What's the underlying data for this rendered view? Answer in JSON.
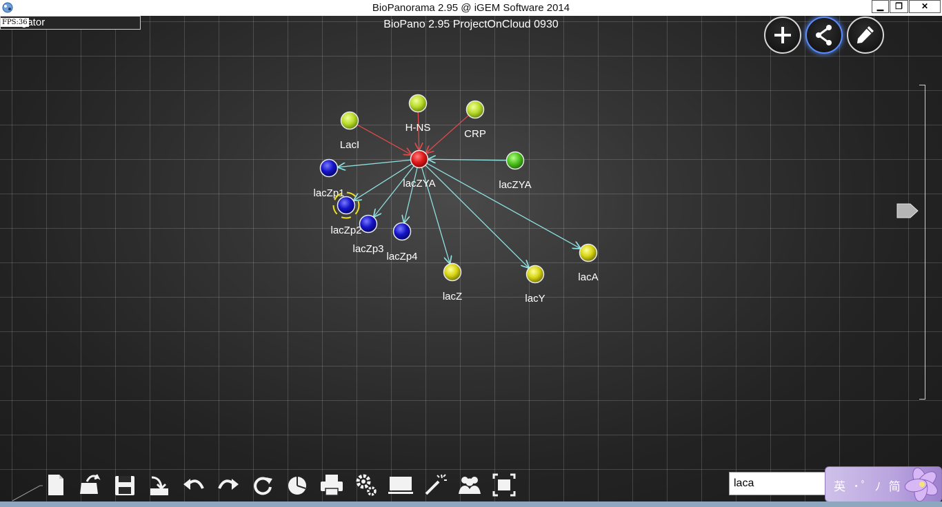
{
  "window": {
    "title": "BioPanorama 2.95 @ iGEM Software 2014",
    "app_icon": "biopanorama-app-icon",
    "minimize_glyph": "▁",
    "maximize_glyph": "❐",
    "close_glyph": "✕"
  },
  "navigator": {
    "label": "gator",
    "fps": "FPS:36"
  },
  "project": {
    "name": "BioPano 2.95 ProjectOnCloud 0930"
  },
  "mode_buttons": [
    {
      "name": "add-icon",
      "active": false
    },
    {
      "name": "share-network-icon",
      "active": true
    },
    {
      "name": "pencil-icon",
      "active": false
    }
  ],
  "graph": {
    "nodes": [
      {
        "id": "lacZYA_center",
        "label": "lacZYA",
        "color": "red"
      },
      {
        "id": "LacI",
        "label": "LacI",
        "color": "yellow-green"
      },
      {
        "id": "HNS",
        "label": "H-NS",
        "color": "yellow-green"
      },
      {
        "id": "CRP",
        "label": "CRP",
        "color": "yellow-green"
      },
      {
        "id": "lacZYA_green",
        "label": "lacZYA",
        "color": "green"
      },
      {
        "id": "lacZp1",
        "label": "lacZp1",
        "color": "blue"
      },
      {
        "id": "lacZp2",
        "label": "lacZp2",
        "color": "blue",
        "selected": true
      },
      {
        "id": "lacZp3",
        "label": "lacZp3",
        "color": "blue"
      },
      {
        "id": "lacZp4",
        "label": "lacZp4",
        "color": "blue"
      },
      {
        "id": "lacZ",
        "label": "lacZ",
        "color": "yellow"
      },
      {
        "id": "lacY",
        "label": "lacY",
        "color": "yellow"
      },
      {
        "id": "lacA",
        "label": "lacA",
        "color": "yellow"
      }
    ],
    "edges": [
      {
        "from": "LacI",
        "to": "lacZYA_center",
        "type": "regulation"
      },
      {
        "from": "HNS",
        "to": "lacZYA_center",
        "type": "regulation"
      },
      {
        "from": "CRP",
        "to": "lacZYA_center",
        "type": "regulation"
      },
      {
        "from": "lacZYA_green",
        "to": "lacZYA_center",
        "type": "relation"
      },
      {
        "from": "lacZYA_center",
        "to": "lacZp1",
        "type": "relation"
      },
      {
        "from": "lacZYA_center",
        "to": "lacZp2",
        "type": "relation"
      },
      {
        "from": "lacZYA_center",
        "to": "lacZp3",
        "type": "relation"
      },
      {
        "from": "lacZYA_center",
        "to": "lacZp4",
        "type": "relation"
      },
      {
        "from": "lacZYA_center",
        "to": "lacZ",
        "type": "relation"
      },
      {
        "from": "lacZYA_center",
        "to": "lacY",
        "type": "relation"
      },
      {
        "from": "lacZYA_center",
        "to": "lacA",
        "type": "relation"
      }
    ]
  },
  "colors": {
    "regulation_edge": "#e04a4a",
    "relation_edge": "#8fe0e0",
    "red": "#e01818",
    "yellow-green": "#b8dc2a",
    "green": "#4cc21c",
    "blue": "#1414c8",
    "yellow": "#d6d412",
    "selection_ring": "#f0e020"
  },
  "toolbar": [
    "new-file-icon",
    "open-file-icon",
    "save-icon",
    "export-icon",
    "undo-icon",
    "redo-icon",
    "refresh-icon",
    "pie-chart-icon",
    "print-icon",
    "settings-icon",
    "presentation-icon",
    "magic-wand-icon",
    "users-icon",
    "fit-screen-icon"
  ],
  "search": {
    "value": "laca"
  },
  "ime": {
    "text": "英 ･ﾟ ﾉ 简"
  }
}
